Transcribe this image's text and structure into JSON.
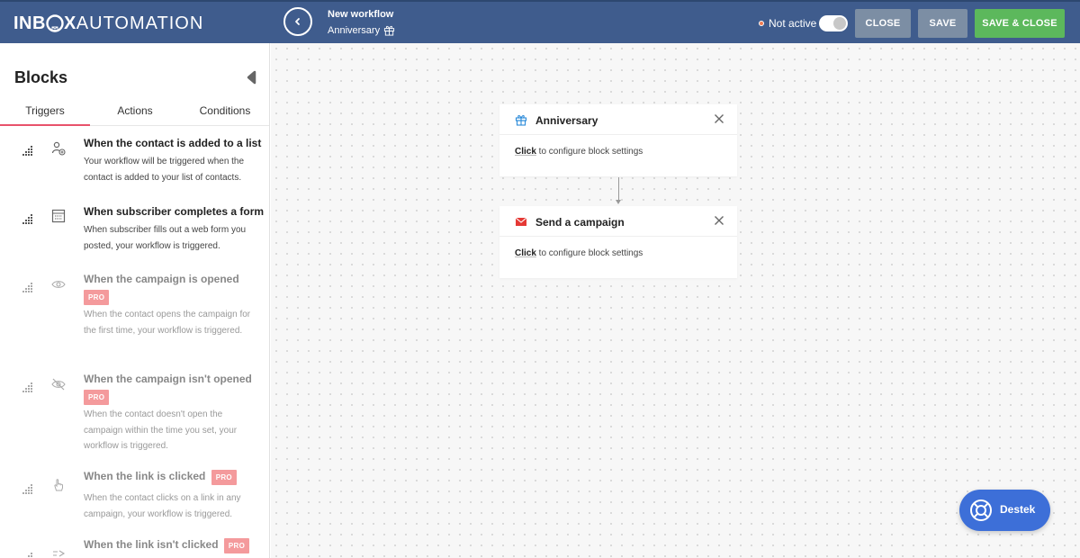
{
  "header": {
    "logo_bold": "INB",
    "logo_x": "X",
    "logo_light": "AUTOMATION",
    "workflow_title": "New workflow",
    "workflow_name": "Anniversary",
    "status": "Not active",
    "close_label": "CLOSE",
    "save_label": "SAVE",
    "save_close_label": "SAVE & CLOSE",
    "colors": {
      "bar": "#3f5c8d",
      "save_close": "#5cb85c",
      "secondary": "#7c8ea4",
      "status_dot": "#f07a52"
    }
  },
  "sidebar": {
    "title": "Blocks",
    "tabs": [
      {
        "label": "Triggers",
        "active": true
      },
      {
        "label": "Actions",
        "active": false
      },
      {
        "label": "Conditions",
        "active": false
      }
    ],
    "pro_label": "PRO",
    "items": [
      {
        "title": "When the contact is added to a list",
        "description": "Your workflow will be triggered when the contact is added to your list of contacts.",
        "icon": "user-add-icon",
        "pro": false
      },
      {
        "title": "When subscriber completes a form",
        "description": "When subscriber fills out a web form you posted, your workflow is triggered.",
        "icon": "form-icon",
        "pro": false
      },
      {
        "title": "When the campaign is opened",
        "description": "When the contact opens the campaign for the first time, your workflow is triggered.",
        "icon": "eye-icon",
        "pro": true
      },
      {
        "title": "When the campaign isn't opened",
        "description": "When the contact doesn't open the campaign within the time you set, your workflow is triggered.",
        "icon": "eye-off-icon",
        "pro": true
      },
      {
        "title": "When the link is clicked",
        "description": "When the contact clicks on a link in any campaign, your workflow is triggered.",
        "icon": "pointer-icon",
        "pro": true
      },
      {
        "title": "When the link isn't clicked",
        "description": "",
        "icon": "link-off-icon",
        "pro": true
      }
    ]
  },
  "canvas": {
    "blocks": [
      {
        "title": "Anniversary",
        "icon": "gift-icon",
        "click_label": "Click",
        "body_text": " to configure block settings"
      },
      {
        "title": "Send a campaign",
        "icon": "envelope-icon",
        "click_label": "Click",
        "body_text": " to configure block settings"
      }
    ]
  },
  "support": {
    "label": "Destek",
    "icon": "lifebuoy-icon",
    "color": "#3d6fd8"
  }
}
